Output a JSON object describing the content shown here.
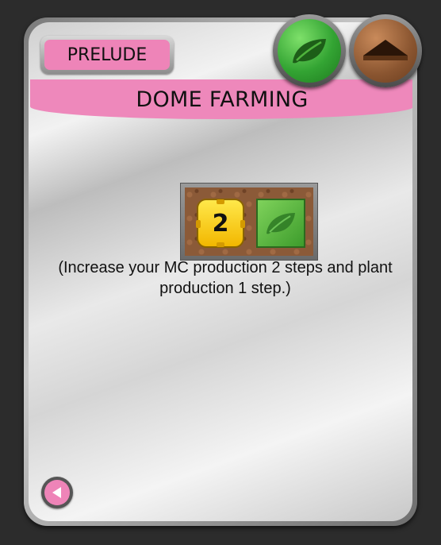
{
  "card": {
    "type_label": "PRELUDE",
    "title": "DOME FARMING",
    "tags": [
      {
        "name": "plant",
        "icon": "leaf-icon",
        "color": "#33a433"
      },
      {
        "name": "building",
        "icon": "building-icon",
        "color": "#8a5530"
      }
    ],
    "production": {
      "mc_amount": "2",
      "mc_icon": "megacredit-icon",
      "plant_icon": "leaf-icon"
    },
    "description": "(Increase your MC production 2 steps and plant production 1 step.)",
    "type_color": "#ee84b8"
  },
  "controls": {
    "back_icon": "back-arrow-icon"
  }
}
